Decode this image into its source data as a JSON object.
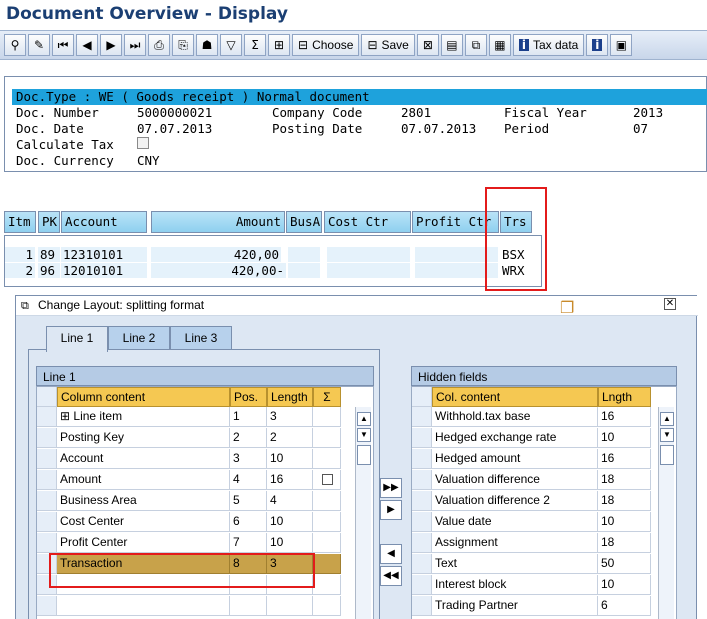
{
  "window": {
    "title": "Document Overview - Display"
  },
  "toolbar": {
    "choose_label": "Choose",
    "save_label": "Save",
    "taxdata_label": "Tax data"
  },
  "header": {
    "doctype_line": "Doc.Type : WE ( Goods receipt ) Normal document",
    "doc_number_label": "Doc. Number",
    "doc_number_value": "5000000021",
    "company_code_label": "Company Code",
    "company_code_value": "2801",
    "fiscal_year_label": "Fiscal Year",
    "fiscal_year_value": "2013",
    "doc_date_label": "Doc. Date",
    "doc_date_value": "07.07.2013",
    "posting_date_label": "Posting Date",
    "posting_date_value": "07.07.2013",
    "period_label": "Period",
    "period_value": "07",
    "calc_tax_label": "Calculate Tax",
    "currency_label": "Doc. Currency",
    "currency_value": "CNY"
  },
  "items": {
    "columns": [
      "Itm",
      "PK",
      "Account",
      "Amount",
      "BusA",
      "Cost Ctr",
      "Profit Ctr",
      "Trs"
    ],
    "rows": [
      {
        "itm": "1",
        "pk": "89",
        "account": "12310101",
        "amount": "420,00",
        "trs": "BSX"
      },
      {
        "itm": "2",
        "pk": "96",
        "account": "12010101",
        "amount": "420,00-",
        "trs": "WRX"
      }
    ]
  },
  "dialog": {
    "title": "Change Layout: splitting format",
    "tabs": [
      "Line 1",
      "Line 2",
      "Line 3"
    ],
    "line1": {
      "title": "Line 1",
      "headers": [
        "Column content",
        "Pos.",
        "Length",
        "Σ"
      ],
      "rows": [
        {
          "content": "Line item",
          "pos": "1",
          "len": "3"
        },
        {
          "content": "Posting Key",
          "pos": "2",
          "len": "2"
        },
        {
          "content": "Account",
          "pos": "3",
          "len": "10"
        },
        {
          "content": "Amount",
          "pos": "4",
          "len": "16"
        },
        {
          "content": "Business Area",
          "pos": "5",
          "len": "4"
        },
        {
          "content": "Cost Center",
          "pos": "6",
          "len": "10"
        },
        {
          "content": "Profit Center",
          "pos": "7",
          "len": "10"
        },
        {
          "content": "Transaction",
          "pos": "8",
          "len": "3"
        }
      ]
    },
    "hidden": {
      "title": "Hidden fields",
      "headers": [
        "Col. content",
        "Lngth"
      ],
      "rows": [
        {
          "content": "Withhold.tax base",
          "len": "16"
        },
        {
          "content": "Hedged exchange rate",
          "len": "10"
        },
        {
          "content": "Hedged amount",
          "len": "16"
        },
        {
          "content": "Valuation difference",
          "len": "18"
        },
        {
          "content": "Valuation difference 2",
          "len": "18"
        },
        {
          "content": "Value date",
          "len": "10"
        },
        {
          "content": "Assignment",
          "len": "18"
        },
        {
          "content": "Text",
          "len": "50"
        },
        {
          "content": "Interest block",
          "len": "10"
        },
        {
          "content": "Trading Partner",
          "len": "6"
        }
      ]
    }
  }
}
